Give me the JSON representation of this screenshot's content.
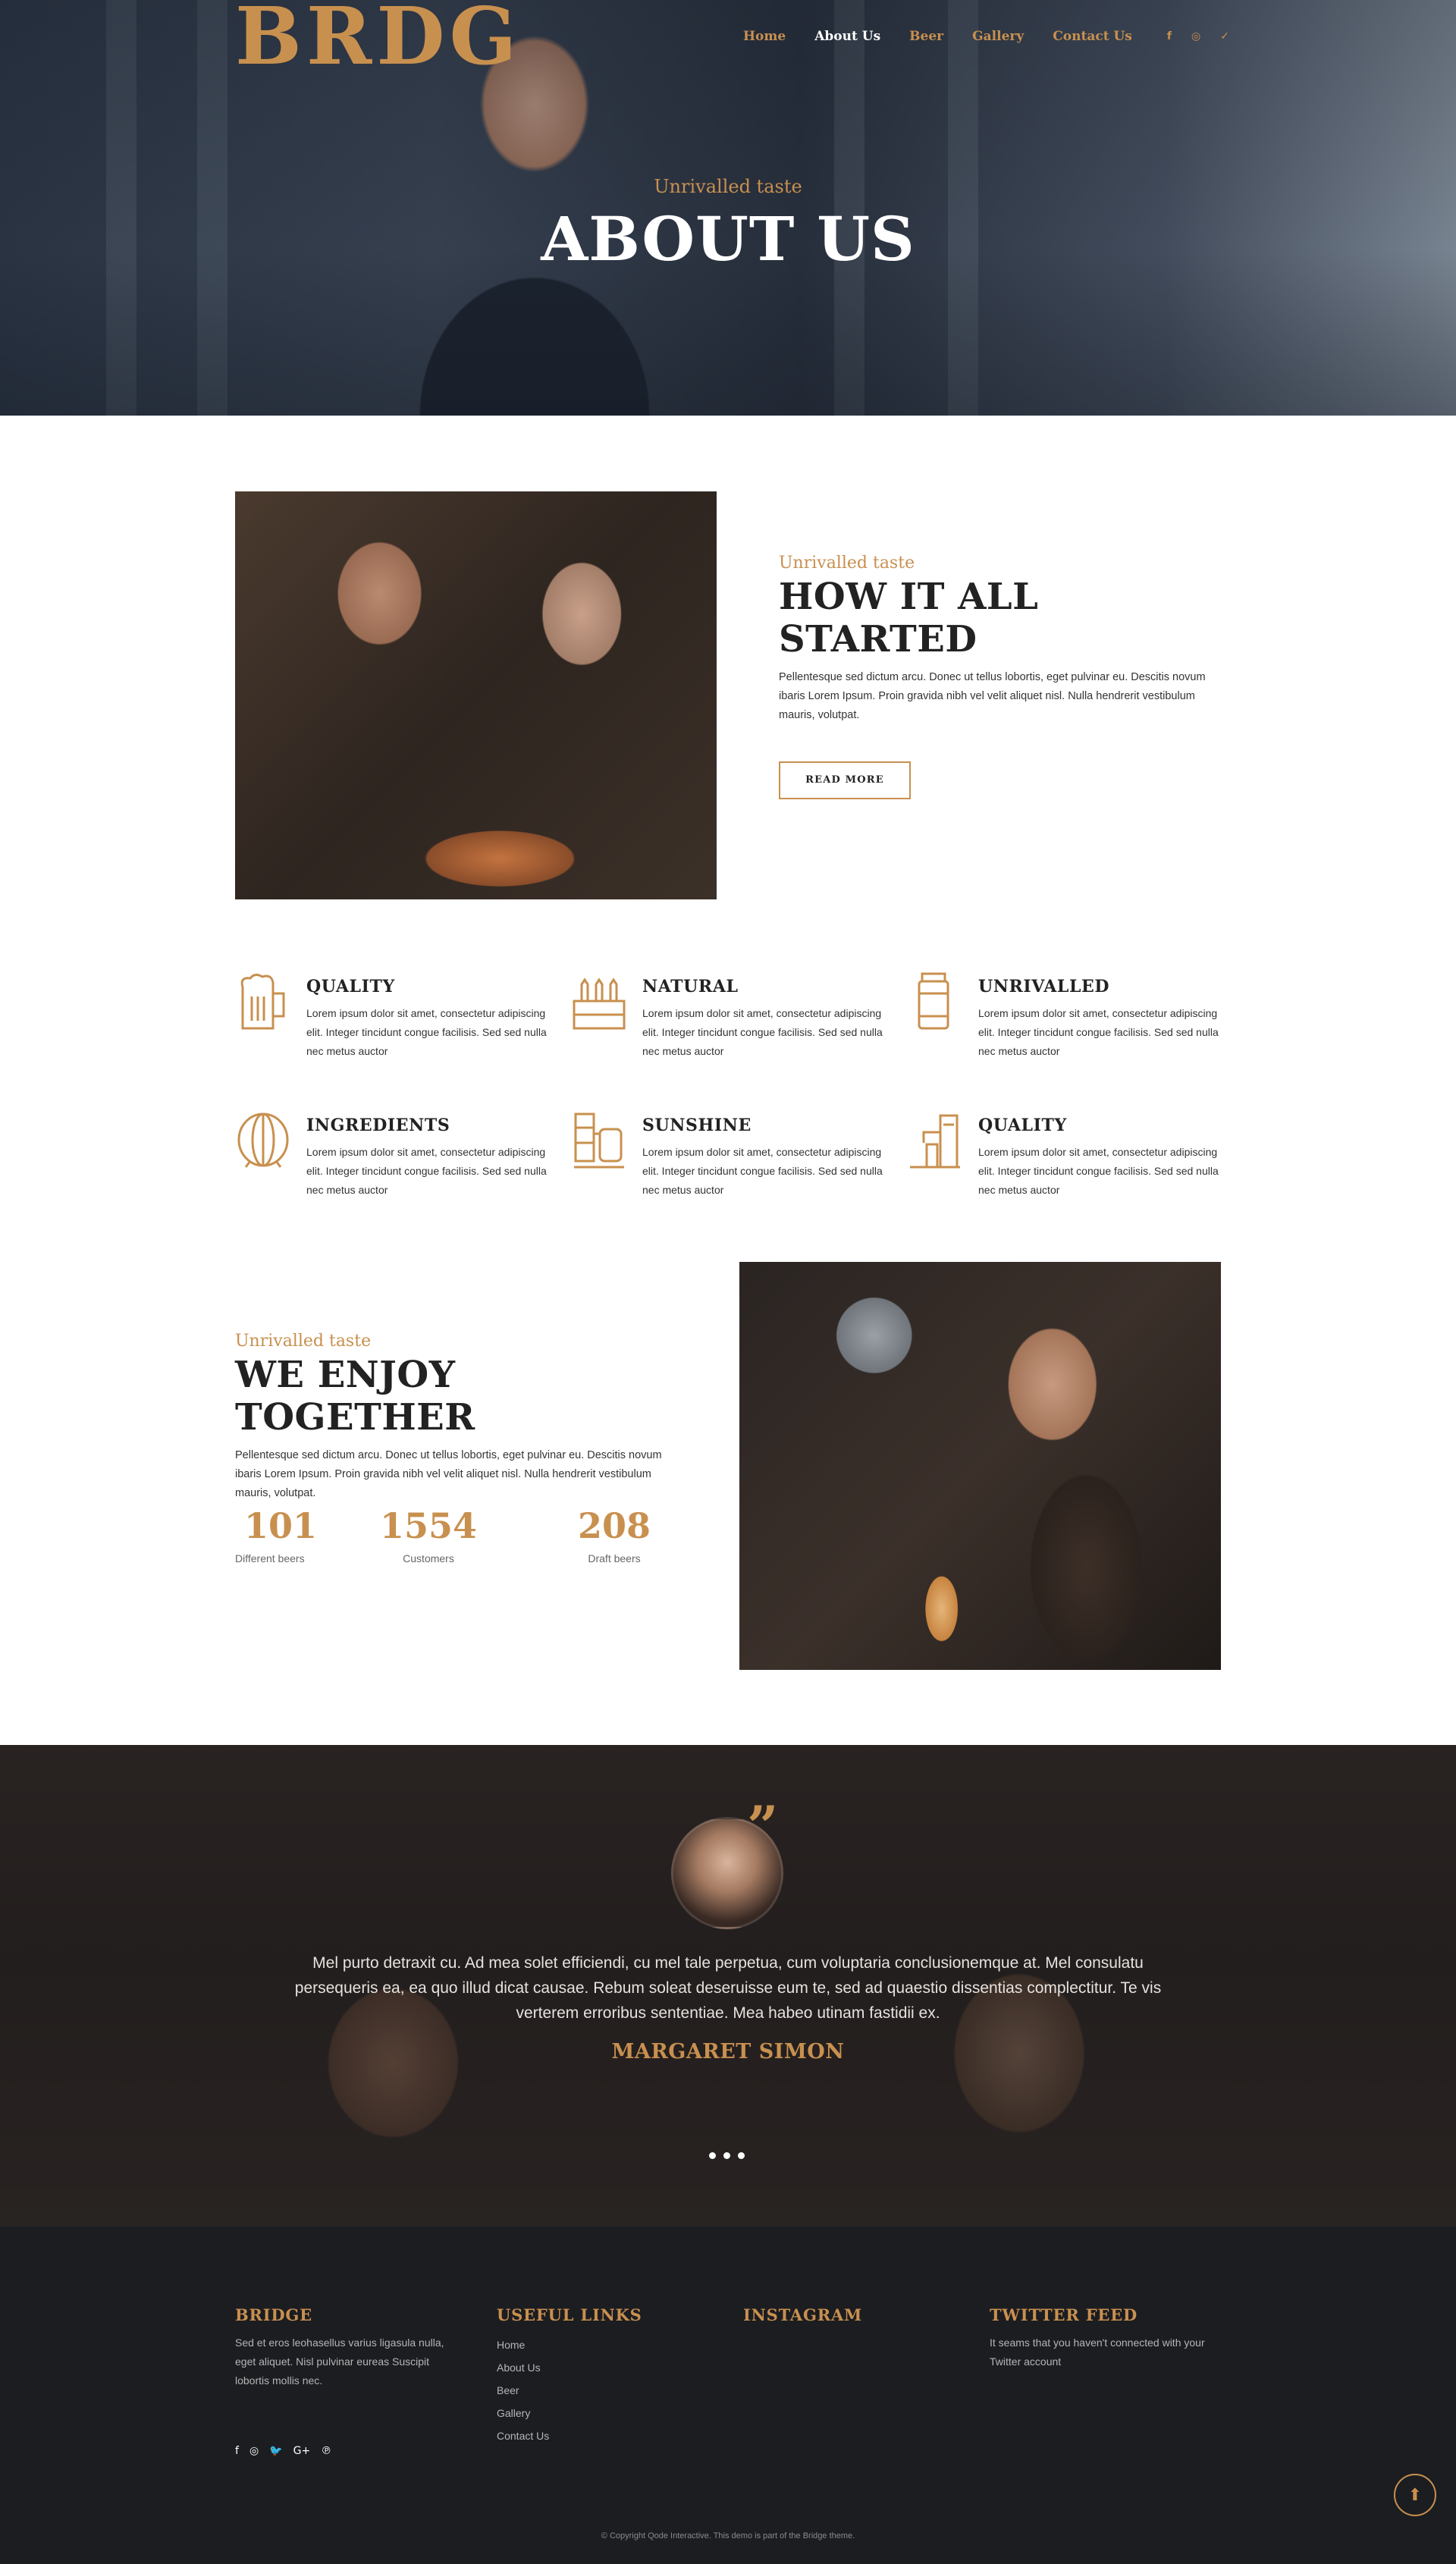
{
  "brand": {
    "logo_text": "BRDG",
    "accent": "#c8904f"
  },
  "nav": {
    "items": [
      {
        "label": "Home",
        "active": false
      },
      {
        "label": "About Us",
        "active": true
      },
      {
        "label": "Beer",
        "active": false
      },
      {
        "label": "Gallery",
        "active": false
      },
      {
        "label": "Contact Us",
        "active": false
      }
    ],
    "social": [
      {
        "icon": "facebook-icon",
        "glyph": "f"
      },
      {
        "icon": "instagram-icon",
        "glyph": "◎"
      },
      {
        "icon": "twitter-icon",
        "glyph": "✓"
      }
    ]
  },
  "hero": {
    "subtitle": "Unrivalled taste",
    "title": "ABOUT US"
  },
  "started": {
    "subtitle": "Unrivalled taste",
    "title": "HOW IT ALL STARTED",
    "text": "Pellentesque sed dictum arcu. Donec ut tellus lobortis, eget pulvinar eu. Descitis novum ibaris Lorem Ipsum. Proin gravida nibh vel velit aliquet nisl. Nulla hendrerit vestibulum mauris, volutpat.",
    "button": "READ MORE"
  },
  "features": [
    {
      "title": "QUALITY",
      "icon": "beer-mug-icon",
      "text": "Lorem ipsum dolor sit amet, consectetur adipiscing elit. Integer tincidunt congue facilisis. Sed sed nulla nec metus auctor"
    },
    {
      "title": "NATURAL",
      "icon": "beer-crate-icon",
      "text": "Lorem ipsum dolor sit amet, consectetur adipiscing elit. Integer tincidunt congue facilisis. Sed sed nulla nec metus auctor"
    },
    {
      "title": "UNRIVALLED",
      "icon": "keg-icon",
      "text": "Lorem ipsum dolor sit amet, consectetur adipiscing elit. Integer tincidunt congue facilisis. Sed sed nulla nec metus auctor"
    },
    {
      "title": "INGREDIENTS",
      "icon": "barrel-icon",
      "text": "Lorem ipsum dolor sit amet, consectetur adipiscing elit. Integer tincidunt congue facilisis. Sed sed nulla nec metus auctor"
    },
    {
      "title": "SUNSHINE",
      "icon": "brewery-tanks-icon",
      "text": "Lorem ipsum dolor sit amet, consectetur adipiscing elit. Integer tincidunt congue facilisis. Sed sed nulla nec metus auctor"
    },
    {
      "title": "QUALITY",
      "icon": "beer-tap-icon",
      "text": "Lorem ipsum dolor sit amet, consectetur adipiscing elit. Integer tincidunt congue facilisis. Sed sed nulla nec metus auctor"
    }
  ],
  "enjoy": {
    "subtitle": "Unrivalled taste",
    "title": "WE ENJOY TOGETHER",
    "text": "Pellentesque sed dictum arcu. Donec ut tellus lobortis, eget pulvinar eu. Descitis novum ibaris Lorem Ipsum. Proin gravida nibh vel velit aliquet nisl. Nulla hendrerit vestibulum mauris, volutpat.",
    "stats": [
      {
        "number": "101",
        "label": "Different beers"
      },
      {
        "number": "1554",
        "label": "Customers"
      },
      {
        "number": "208",
        "label": "Draft beers"
      }
    ]
  },
  "testimonial": {
    "quote_mark": "”",
    "text": "Mel purto detraxit cu. Ad mea solet efficiendi, cu mel tale perpetua, cum voluptaria conclusionemque at. Mel consulatu persequeris ea, ea quo illud dicat causae. Rebum soleat deseruisse eum te, sed ad quaestio dissentias complectitur. Te vis verterem erroribus sententiae. Mea habeo utinam fastidii ex.",
    "author": "MARGARET SIMON",
    "slides": 3
  },
  "footer": {
    "bridge": {
      "title": "BRIDGE",
      "text": "Sed et eros leohasellus varius ligasula nulla, eget aliquet. Nisl pulvinar eureas Suscipit lobortis mollis nec."
    },
    "links": {
      "title": "USEFUL LINKS",
      "items": [
        "Home",
        "About Us",
        "Beer",
        "Gallery",
        "Contact Us"
      ]
    },
    "instagram": {
      "title": "INSTAGRAM"
    },
    "twitter": {
      "title": "TWITTER FEED",
      "text": "It seams that you haven't connected with your Twitter account"
    },
    "social": [
      {
        "icon": "facebook-icon",
        "glyph": "f"
      },
      {
        "icon": "instagram-icon",
        "glyph": "◎"
      },
      {
        "icon": "twitter-icon",
        "glyph": "🐦"
      },
      {
        "icon": "google-plus-icon",
        "glyph": "G+"
      },
      {
        "icon": "pinterest-icon",
        "glyph": "℗"
      }
    ],
    "copyright": "© Copyright Qode Interactive. This demo is part of the Bridge theme."
  },
  "back_to_top": {
    "glyph": "⬆"
  }
}
